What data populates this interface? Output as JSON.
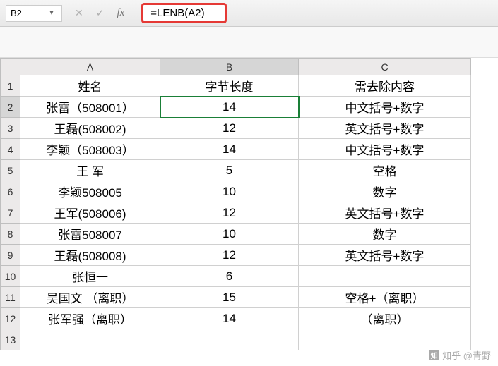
{
  "toolbar": {
    "namebox": "B2",
    "formula": "=LENB(A2)"
  },
  "columns": [
    "A",
    "B",
    "C"
  ],
  "headers": {
    "a": "姓名",
    "b": "字节长度",
    "c": "需去除内容"
  },
  "rows": [
    {
      "n": "1"
    },
    {
      "n": "2",
      "a": "张雷（508001）",
      "b": "14",
      "c": "中文括号+数字"
    },
    {
      "n": "3",
      "a": "王磊(508002)",
      "b": "12",
      "c": "英文括号+数字"
    },
    {
      "n": "4",
      "a": "李颖（508003）",
      "b": "14",
      "c": "中文括号+数字"
    },
    {
      "n": "5",
      "a": "王 军",
      "b": "5",
      "c": "空格"
    },
    {
      "n": "6",
      "a": "李颖508005",
      "b": "10",
      "c": "数字"
    },
    {
      "n": "7",
      "a": "王军(508006)",
      "b": "12",
      "c": "英文括号+数字"
    },
    {
      "n": "8",
      "a": "张雷508007",
      "b": "10",
      "c": "数字"
    },
    {
      "n": "9",
      "a": "王磊(508008)",
      "b": "12",
      "c": "英文括号+数字"
    },
    {
      "n": "10",
      "a": "张恒一",
      "b": "6",
      "c": ""
    },
    {
      "n": "11",
      "a": "吴国文 （离职）",
      "b": "15",
      "c": "空格+（离职）"
    },
    {
      "n": "12",
      "a": "张军强（离职）",
      "b": "14",
      "c": "（离职）"
    },
    {
      "n": "13",
      "a": "",
      "b": "",
      "c": ""
    }
  ],
  "selected": {
    "row": 2,
    "col": "B"
  },
  "watermark": "知乎 @青野"
}
